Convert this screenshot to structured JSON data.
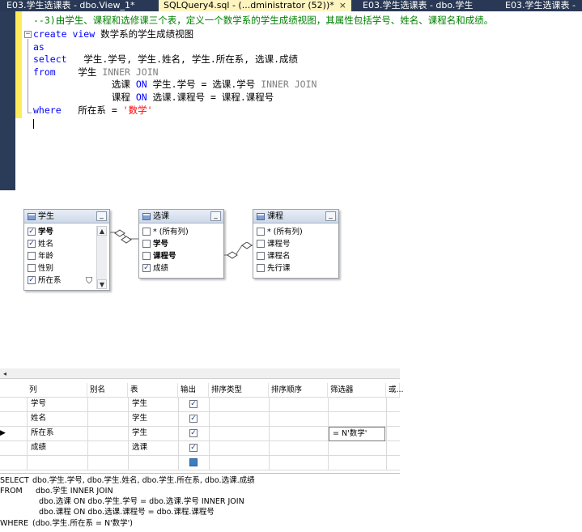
{
  "tabs": [
    {
      "label": "E03.学生选课表 - dbo.View_1*",
      "active": false
    },
    {
      "label": "SQLQuery4.sql - (...dministrator (52))*",
      "active": true
    },
    {
      "label": "E03.学生选课表 - dbo.学生",
      "active": false
    },
    {
      "label": "E03.学生选课表 -",
      "active": false
    }
  ],
  "tab_close_glyph": "×",
  "editor": {
    "comment": "--3)由学生、课程和选修课三个表，定义一个数学系的学生成绩视图，其属性包括学号、姓名、课程名和成绩。",
    "l1_kw": "create view",
    "l1_rest": " 数学系的学生成绩视图",
    "l2_kw": "as",
    "l3_kw": "select",
    "l3_rest": "   学生.学号, 学生.姓名, 学生.所在系, 选课.成绩",
    "l4_kw": "from",
    "l4_rest": "    学生 ",
    "l4_gray": "INNER JOIN",
    "l5_a": "              选课 ",
    "l5_kw": "ON",
    "l5_b": " 学生.学号 = 选课.学号 ",
    "l5_gray": "INNER JOIN",
    "l6_a": "              课程 ",
    "l6_kw": "ON",
    "l6_b": " 选课.课程号 = 课程.课程号",
    "l7_kw": "where",
    "l7_rest": "   所在系 = ",
    "l7_str": "'数学'"
  },
  "diagram": {
    "tables": [
      {
        "title": "学生",
        "rows": [
          {
            "label": "学号",
            "checked": true,
            "bold": true
          },
          {
            "label": "姓名",
            "checked": true,
            "bold": false
          },
          {
            "label": "年龄",
            "checked": false,
            "bold": false
          },
          {
            "label": "性别",
            "checked": false,
            "bold": false
          },
          {
            "label": "所在系",
            "checked": true,
            "bold": false
          }
        ]
      },
      {
        "title": "选课",
        "rows": [
          {
            "label": "* (所有列)",
            "checked": false,
            "bold": false
          },
          {
            "label": "学号",
            "checked": false,
            "bold": true
          },
          {
            "label": "课程号",
            "checked": false,
            "bold": true
          },
          {
            "label": "成绩",
            "checked": true,
            "bold": false
          }
        ]
      },
      {
        "title": "课程",
        "rows": [
          {
            "label": "* (所有列)",
            "checked": false,
            "bold": false
          },
          {
            "label": "课程号",
            "checked": false,
            "bold": false
          },
          {
            "label": "课程名",
            "checked": false,
            "bold": false
          },
          {
            "label": "先行课",
            "checked": false,
            "bold": false
          }
        ]
      }
    ],
    "minimize_glyph": "_",
    "check_glyph": "✓",
    "filter_glyph": "⛉",
    "scroll_up": "▲",
    "scroll_down": "▼"
  },
  "grid": {
    "scroll_left": "◂",
    "headers": [
      "列",
      "别名",
      "表",
      "输出",
      "排序类型",
      "排序顺序",
      "筛选器",
      "或..."
    ],
    "rows": [
      {
        "column": "学号",
        "alias": "",
        "table": "学生",
        "output": true,
        "filter": ""
      },
      {
        "column": "姓名",
        "alias": "",
        "table": "学生",
        "output": true,
        "filter": ""
      },
      {
        "column": "所在系",
        "alias": "",
        "table": "学生",
        "output": true,
        "filter": "= N'数学'"
      },
      {
        "column": "成绩",
        "alias": "",
        "table": "选课",
        "output": true,
        "filter": ""
      }
    ],
    "current_row_indicator": "▶"
  },
  "sql_pane": {
    "l1_kw": "SELECT",
    "l1": "dbo.学生.学号, dbo.学生.姓名, dbo.学生.所在系, dbo.选课.成绩",
    "l2_kw": "FROM",
    "l2": "dbo.学生 INNER JOIN",
    "l3": "dbo.选课 ON dbo.学生.学号 = dbo.选课.学号 INNER JOIN",
    "l4": "dbo.课程 ON dbo.选课.课程号 = dbo.课程.课程号",
    "l5_kw": "WHERE",
    "l5": "(dbo.学生.所在系 = N'数学')"
  },
  "colors": {
    "tab_active": "#fdf4bf",
    "frame": "#2b3c59",
    "keyword": "#0000ff",
    "comment": "#008000",
    "string": "#ff0000",
    "gutter_marker": "#ffec5c"
  }
}
